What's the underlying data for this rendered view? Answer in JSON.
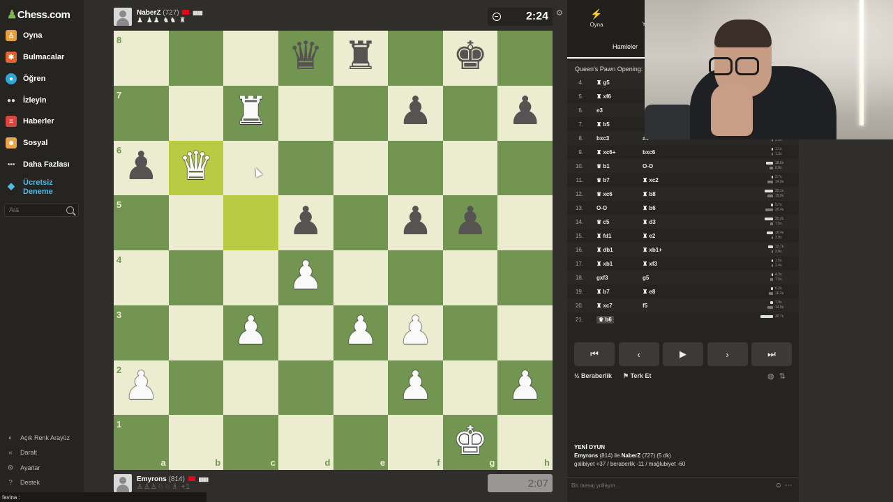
{
  "sidebar": {
    "logo": "Chess.com",
    "nav": [
      {
        "label": "Oyna",
        "icon": "play-icon",
        "color": "#e8a03a"
      },
      {
        "label": "Bulmacalar",
        "icon": "puzzle-icon",
        "color": "#e5632d"
      },
      {
        "label": "Öğren",
        "icon": "learn-icon",
        "color": "#2fa7d7"
      },
      {
        "label": "İzleyin",
        "icon": "binoculars-icon",
        "color": "#bbbbbb"
      },
      {
        "label": "Haberler",
        "icon": "news-icon",
        "color": "#d9473e"
      },
      {
        "label": "Sosyal",
        "icon": "social-icon",
        "color": "#e7a84b"
      },
      {
        "label": "Daha Fazlası",
        "icon": "more-icon",
        "color": "#bbbbbb"
      }
    ],
    "trial": {
      "line1": "Ücretsiz",
      "line2": "Deneme"
    },
    "search_placeholder": "Ara",
    "footer": [
      {
        "label": "Açık Renk Arayüz",
        "icon": "theme-toggle-icon"
      },
      {
        "label": "Daralt",
        "icon": "collapse-icon"
      },
      {
        "label": "Ayarlar",
        "icon": "settings-icon"
      },
      {
        "label": "Destek",
        "icon": "help-icon"
      }
    ],
    "taskbar_text": "favina :"
  },
  "top_player": {
    "name": "NaberZ",
    "rating": "(727)",
    "captured": "♟ ♟♟ ♞♞ ♜",
    "clock": "2:24"
  },
  "bottom_player": {
    "name": "Emyrons",
    "rating": "(814)",
    "captured": "♙♙♙♘♘♗ +1",
    "clock": "2:07"
  },
  "board": {
    "files": [
      "a",
      "b",
      "c",
      "d",
      "e",
      "f",
      "g",
      "h"
    ],
    "ranks": [
      "8",
      "7",
      "6",
      "5",
      "4",
      "3",
      "2",
      "1"
    ],
    "highlighted": [
      "b6",
      "c5"
    ],
    "pieces": {
      "d8": "bq",
      "e8": "br",
      "g8": "bk",
      "c7": "wr",
      "f7": "bp",
      "h7": "bp",
      "a6": "bp",
      "b6": "wq",
      "d5": "bp",
      "f5": "bp",
      "g5": "bp",
      "d4": "wp",
      "c3": "wp",
      "e3": "wp",
      "f3": "wp",
      "a2": "wp",
      "f2": "wp",
      "h2": "wp",
      "g1": "wk"
    }
  },
  "panel": {
    "tabs": [
      {
        "label": "Oyna",
        "icon": "bolt-icon"
      },
      {
        "label": "Y",
        "icon": "new-game-icon"
      }
    ],
    "moves_tab": "Hamleler",
    "opening": "Queen's Pawn Opening: Ch",
    "moves": [
      {
        "n": "4.",
        "w": "g5",
        "wp": "♜",
        "b": "",
        "bp": "",
        "t": [
          "",
          ""
        ]
      },
      {
        "n": "5.",
        "w": "xf6",
        "wp": "♜",
        "b": "",
        "bp": "",
        "t": [
          "",
          ""
        ]
      },
      {
        "n": "6.",
        "w": "e3",
        "wp": "",
        "b": "",
        "bp": "",
        "t": [
          "",
          ""
        ]
      },
      {
        "n": "7.",
        "w": "b5",
        "wp": "♜",
        "b": "",
        "bp": "",
        "t": [
          "",
          ""
        ]
      },
      {
        "n": "8.",
        "w": "bxc3",
        "wp": "",
        "b": "a6",
        "bp": "",
        "t": [
          "1.5s",
          "2.8s"
        ]
      },
      {
        "n": "9.",
        "w": "xc6+",
        "wp": "♜",
        "b": "bxc6",
        "bp": "",
        "t": [
          "1.1s",
          "1.3s"
        ]
      },
      {
        "n": "10.",
        "w": "b1",
        "wp": "♛",
        "b": "O-O",
        "bp": "",
        "t": [
          "18.6s",
          "8.8s"
        ]
      },
      {
        "n": "11.",
        "w": "b7",
        "wp": "♛",
        "b": "xc2",
        "bp": "♜",
        "t": [
          "2.7s",
          "14.0s"
        ]
      },
      {
        "n": "12.",
        "w": "xc6",
        "wp": "♛",
        "b": "b8",
        "bp": "♜",
        "t": [
          "22.1s",
          "15.0s"
        ]
      },
      {
        "n": "13.",
        "w": "O-O",
        "wp": "",
        "b": "b6",
        "bp": "♜",
        "t": [
          "5.7s",
          "20.4s"
        ]
      },
      {
        "n": "14.",
        "w": "c5",
        "wp": "♛",
        "b": "d3",
        "bp": "♜",
        "t": [
          "22.2s",
          "7.5s"
        ]
      },
      {
        "n": "15.",
        "w": "fd1",
        "wp": "♜",
        "b": "e2",
        "bp": "♜",
        "t": [
          "16.4s",
          "3.0s"
        ]
      },
      {
        "n": "16.",
        "w": "db1",
        "wp": "♜",
        "b": "xb1+",
        "bp": "♜",
        "t": [
          "12.7s",
          "3.8s"
        ]
      },
      {
        "n": "17.",
        "w": "xb1",
        "wp": "♜",
        "b": "xf3",
        "bp": "♜",
        "t": [
          "1.5s",
          "2.4s"
        ]
      },
      {
        "n": "18.",
        "w": "gxf3",
        "wp": "",
        "b": "g5",
        "bp": "",
        "t": [
          "4.3s",
          "7.5s"
        ]
      },
      {
        "n": "19.",
        "w": "b7",
        "wp": "♜",
        "b": "e8",
        "bp": "♜",
        "t": [
          "6.2s",
          "10.2s"
        ]
      },
      {
        "n": "20.",
        "w": "xc7",
        "wp": "♜",
        "b": "f5",
        "bp": "",
        "t": [
          "7.9s",
          "14.0s"
        ]
      },
      {
        "n": "21.",
        "w": "b6",
        "wp": "♛",
        "b": "",
        "bp": "",
        "t": [
          "32.7s",
          ""
        ]
      }
    ],
    "draw_label": "Beraberlik",
    "resign_label": "Terk Et",
    "newgame": {
      "title": "YENİ OYUN",
      "white": "Emyrons",
      "white_rating": "(814)",
      "connector": "ile",
      "black": "NaberZ",
      "black_rating": "(727)",
      "time": "(5 dk)",
      "result_line": "galibiyet +37 / beraberlik -11 / mağlubiyet -60"
    },
    "chat_placeholder": "Bir mesaj yollayın..."
  },
  "colors": {
    "board_light": "#ebecd0",
    "board_dark": "#739552",
    "highlight": "#b9ca43",
    "trial_accent": "#4fb9e8"
  }
}
